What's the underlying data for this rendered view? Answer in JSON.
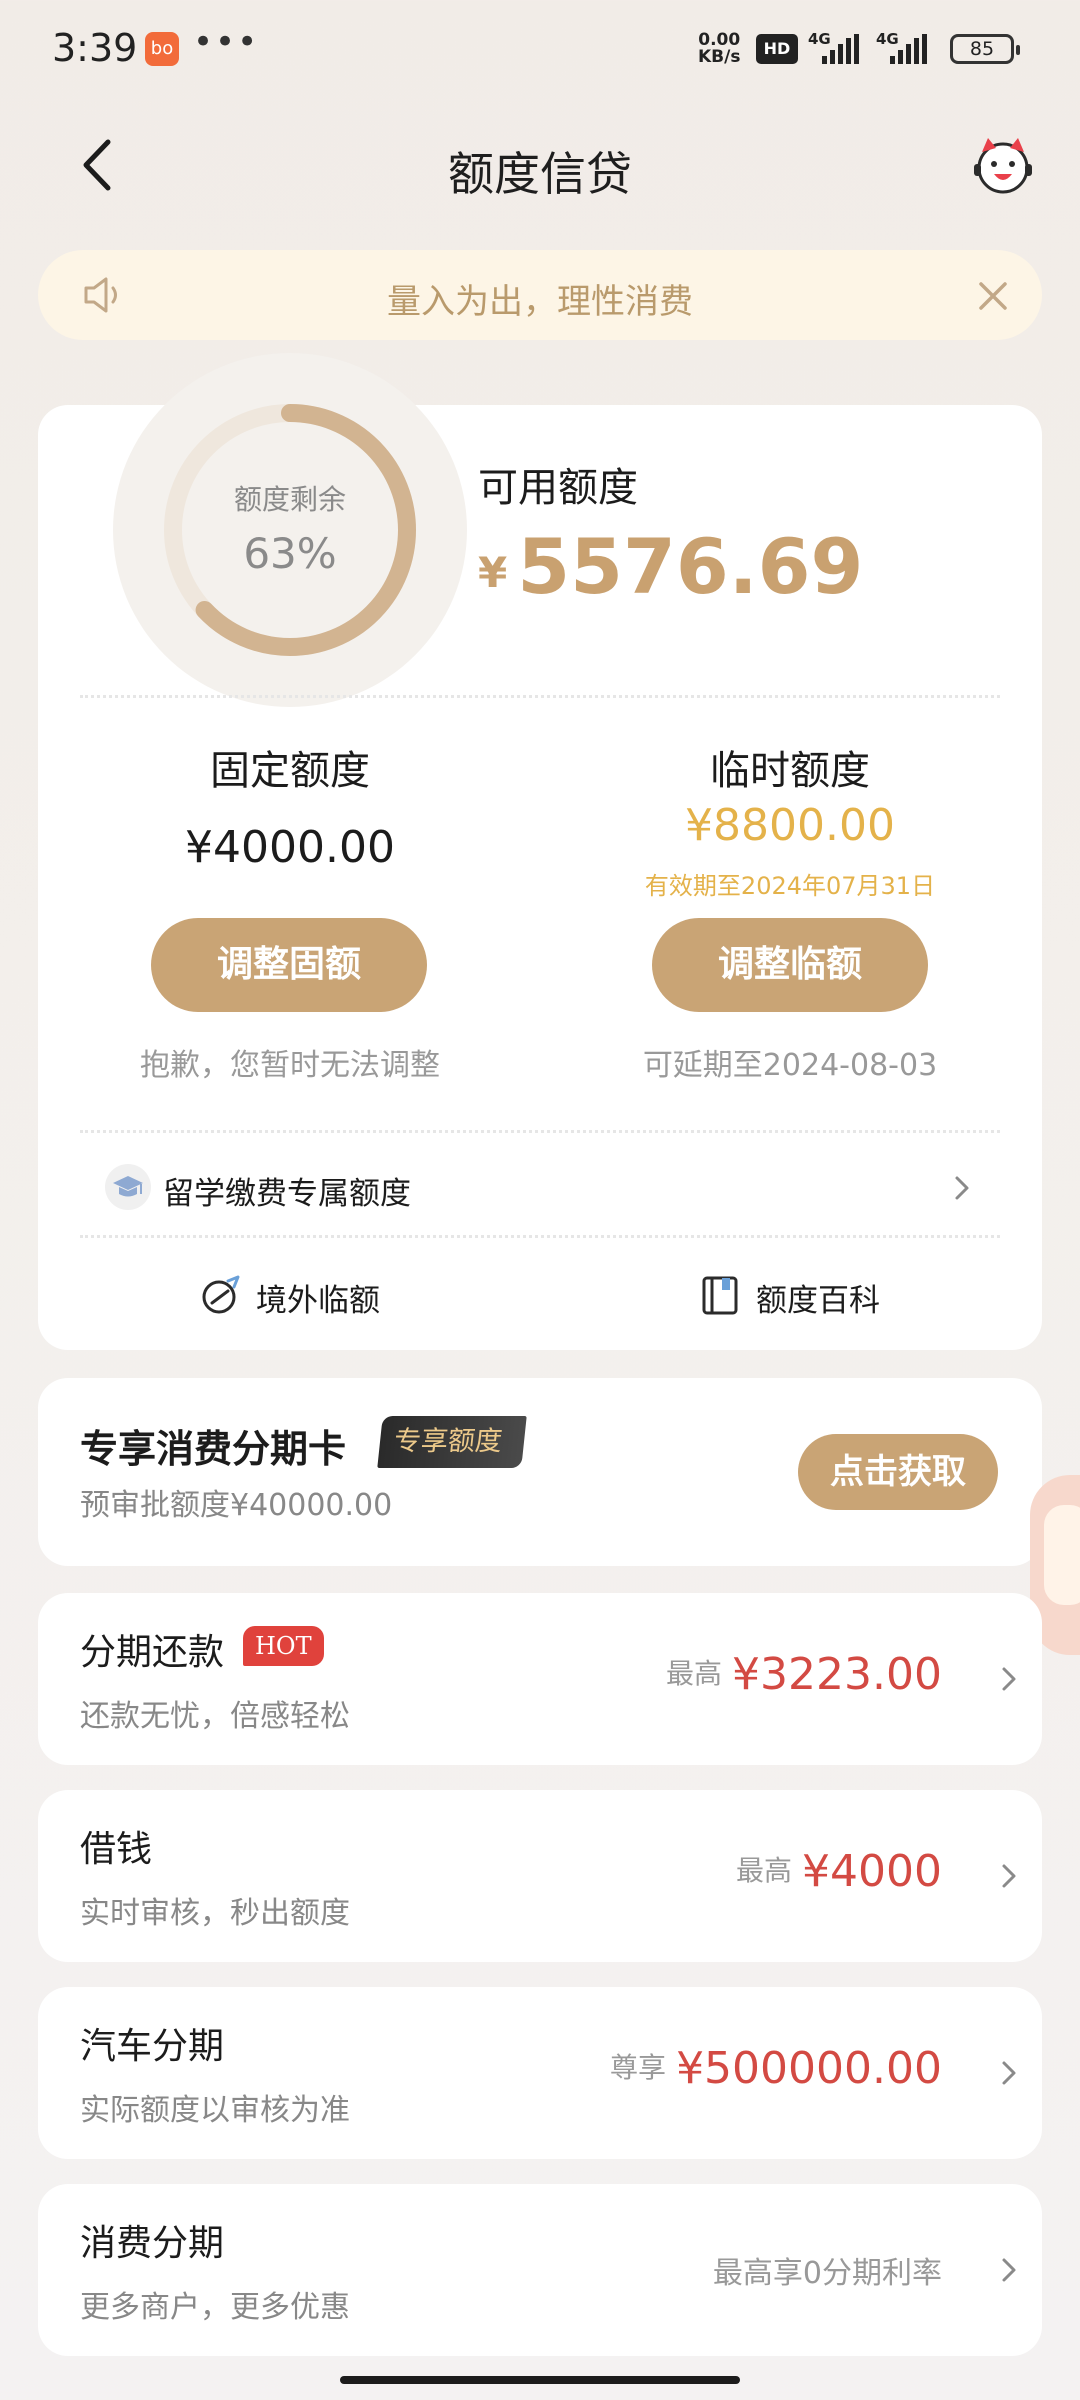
{
  "status_bar": {
    "time": "3:39",
    "app_icon": "bo",
    "dots": "•••",
    "net_speed": "0.00",
    "net_unit": "KB/s",
    "hd": "HD",
    "signal_label": "4G",
    "battery": "85"
  },
  "nav": {
    "title": "额度信贷"
  },
  "notice": {
    "text": "量入为出，理性消费"
  },
  "credit": {
    "remaining_label": "额度剩余",
    "remaining_percent_text": "63%",
    "remaining_fraction": 0.63,
    "available_label": "可用额度",
    "currency": "¥",
    "available_amount": "5576.69",
    "fixed": {
      "title": "固定额度",
      "amount": "¥4000.00",
      "button": "调整固额",
      "note": "抱歉，您暂时无法调整"
    },
    "temporary": {
      "title": "临时额度",
      "amount": "¥8800.00",
      "validity": "有效期至2024年07月31日",
      "button": "调整临额",
      "note": "可延期至2024-08-03"
    },
    "study_abroad": "留学缴费专属额度",
    "overseas": "境外临额",
    "encyclopedia": "额度百科"
  },
  "promo": {
    "title": "专享消费分期卡",
    "tag": "专享额度",
    "subtitle": "预审批额度¥40000.00",
    "button": "点击获取"
  },
  "services": [
    {
      "title": "分期还款",
      "badge": "HOT",
      "subtitle": "还款无忧，倍感轻松",
      "prefix": "最高",
      "amount": "¥3223.00"
    },
    {
      "title": "借钱",
      "subtitle": "实时审核，秒出额度",
      "prefix": "最高",
      "amount": "¥4000"
    },
    {
      "title": "汽车分期",
      "subtitle": "实际额度以审核为准",
      "prefix": "尊享",
      "amount": "¥500000.00"
    },
    {
      "title": "消费分期",
      "subtitle": "更多商户，更多优惠",
      "text": "最高享0分期利率"
    }
  ],
  "colors": {
    "accent_gold": "#c9a475",
    "amount_gold": "#c9a170",
    "temp_yellow": "#e4b24a",
    "amount_red": "#d34a43",
    "hot_red": "#e0423c",
    "notice_bg": "#fdf5e6"
  }
}
